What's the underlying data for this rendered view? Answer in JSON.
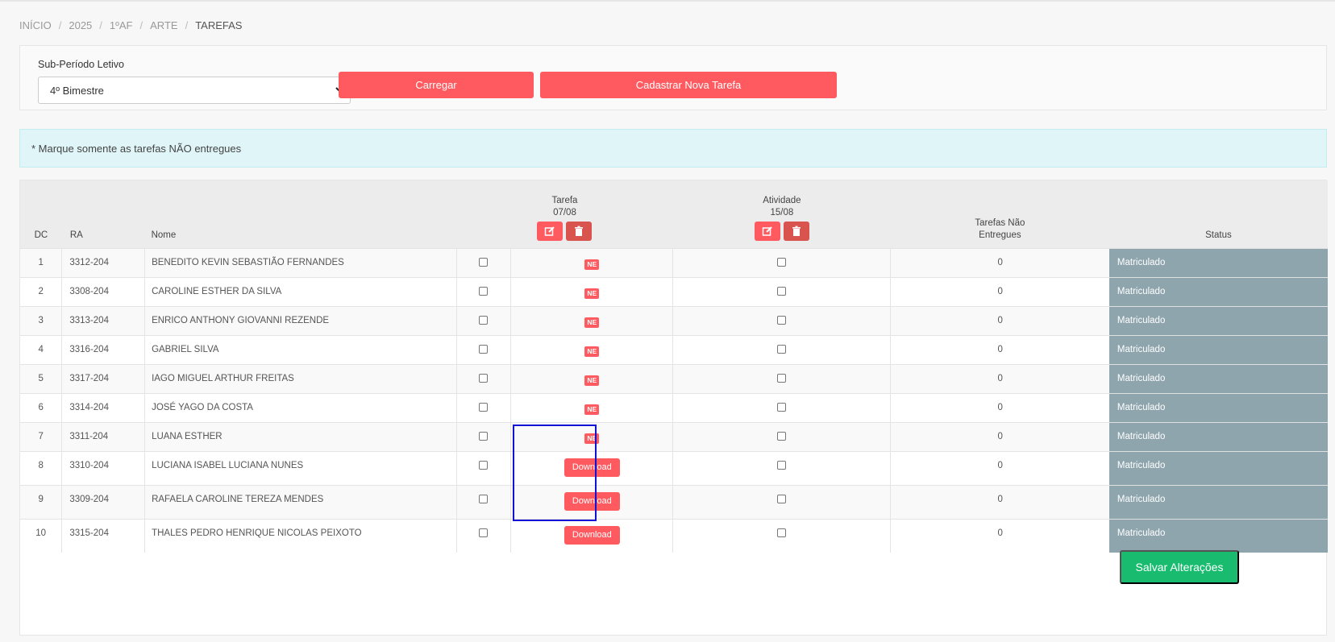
{
  "breadcrumb": [
    "INÍCIO",
    "2025",
    "1ºAF",
    "ARTE",
    "TAREFAS"
  ],
  "filter": {
    "label": "Sub-Período Letivo",
    "selected": "4º Bimestre",
    "load_button": "Carregar",
    "new_task_button": "Cadastrar Nova Tarefa"
  },
  "info_message": "* Marque somente as tarefas NÃO entregues",
  "table": {
    "headers": {
      "dc": "DC",
      "ra": "RA",
      "nome": "Nome",
      "tarefa_title": "Tarefa",
      "tarefa_date": "07/08",
      "atividade_title": "Atividade",
      "atividade_date": "15/08",
      "nao_entregues_1": "Tarefas Não",
      "nao_entregues_2": "Entregues",
      "status": "Status"
    },
    "ne_badge": "NE",
    "download_label": "Download",
    "rows": [
      {
        "dc": "1",
        "ra": "3312-204",
        "nome": "BENEDITO KEVIN SEBASTIÃO FERNANDES",
        "tarefa": "NE",
        "count": "0",
        "status": "Matriculado"
      },
      {
        "dc": "2",
        "ra": "3308-204",
        "nome": "CAROLINE ESTHER DA SILVA",
        "tarefa": "NE",
        "count": "0",
        "status": "Matriculado"
      },
      {
        "dc": "3",
        "ra": "3313-204",
        "nome": "ENRICO ANTHONY GIOVANNI REZENDE",
        "tarefa": "NE",
        "count": "0",
        "status": "Matriculado"
      },
      {
        "dc": "4",
        "ra": "3316-204",
        "nome": "GABRIEL SILVA",
        "tarefa": "NE",
        "count": "0",
        "status": "Matriculado"
      },
      {
        "dc": "5",
        "ra": "3317-204",
        "nome": "IAGO MIGUEL ARTHUR FREITAS",
        "tarefa": "NE",
        "count": "0",
        "status": "Matriculado"
      },
      {
        "dc": "6",
        "ra": "3314-204",
        "nome": "JOSÉ YAGO DA COSTA",
        "tarefa": "NE",
        "count": "0",
        "status": "Matriculado"
      },
      {
        "dc": "7",
        "ra": "3311-204",
        "nome": "LUANA ESTHER",
        "tarefa": "NE",
        "count": "0",
        "status": "Matriculado"
      },
      {
        "dc": "8",
        "ra": "3310-204",
        "nome": "LUCIANA ISABEL LUCIANA NUNES",
        "tarefa": "Download",
        "count": "0",
        "status": "Matriculado"
      },
      {
        "dc": "9",
        "ra": "3309-204",
        "nome": "RAFAELA CAROLINE TEREZA MENDES",
        "tarefa": "Download",
        "count": "0",
        "status": "Matriculado"
      },
      {
        "dc": "10",
        "ra": "3315-204",
        "nome": "THALES PEDRO HENRIQUE NICOLAS PEIXOTO",
        "tarefa": "Download",
        "count": "0",
        "status": "Matriculado"
      }
    ]
  },
  "save_button": "Salvar Alterações",
  "colors": {
    "accent_red": "#ff5a5f",
    "status_bg": "#8ea5ae",
    "save_green": "#19bc6f",
    "highlight_blue": "#1212d6"
  }
}
